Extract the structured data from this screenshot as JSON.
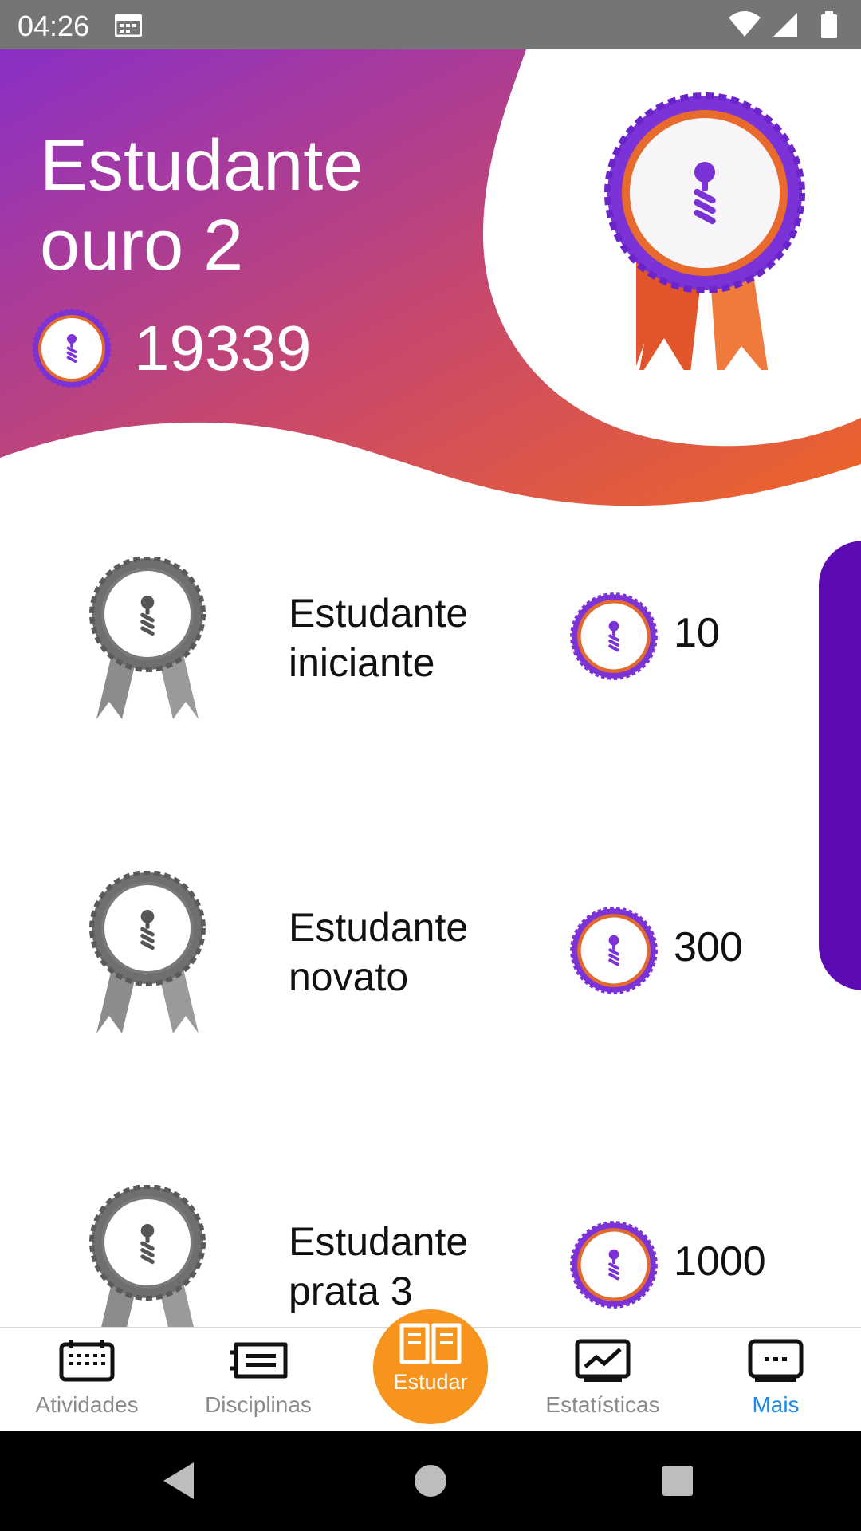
{
  "status_bar": {
    "time": "04:26",
    "left_icons": [
      "calendar-icon"
    ],
    "right_icons": [
      "wifi-icon",
      "signal-icon",
      "battery-icon"
    ]
  },
  "header": {
    "title": "Estudante ouro 2",
    "points": "19339",
    "colors": {
      "gradient_start": "#8a2fc7",
      "gradient_end": "#ef6526"
    }
  },
  "ranks": [
    {
      "name": "Estudante iniciante",
      "points": "10"
    },
    {
      "name": "Estudante novato",
      "points": "300"
    },
    {
      "name": "Estudante prata 3",
      "points": "1000"
    }
  ],
  "bottom_nav": {
    "items": [
      {
        "label": "Atividades",
        "icon": "calendar-icon"
      },
      {
        "label": "Disciplinas",
        "icon": "list-icon"
      },
      {
        "label": "Estudar",
        "icon": "book-icon"
      },
      {
        "label": "Estatísticas",
        "icon": "chart-icon"
      },
      {
        "label": "Mais",
        "icon": "more-icon"
      }
    ],
    "active": "Mais",
    "colors": {
      "active": "#1e88e5",
      "inactive": "#8a8a8a",
      "study": "#f7941d"
    }
  },
  "android_nav": {
    "icons": [
      "back-icon",
      "home-icon",
      "recents-icon"
    ]
  },
  "side_tab_color": "#5b0ab4"
}
